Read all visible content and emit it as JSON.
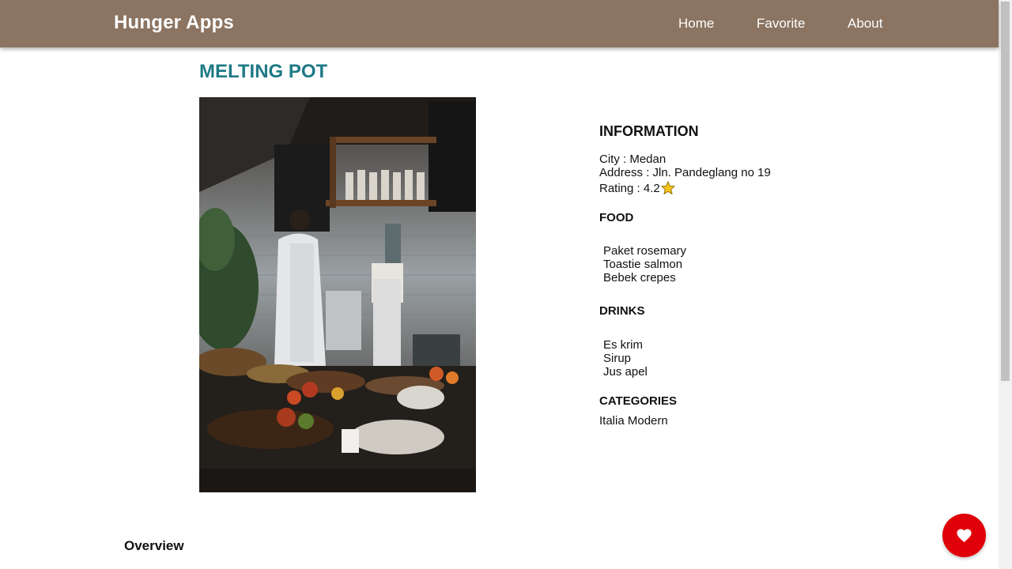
{
  "app": {
    "title": "Hunger Apps"
  },
  "nav": [
    {
      "label": "Home"
    },
    {
      "label": "Favorite"
    },
    {
      "label": "About"
    }
  ],
  "restaurant": {
    "name": "MELTING POT",
    "info_heading": "INFORMATION",
    "city_text": "City : Medan",
    "address_text": "Address : Jln. Pandeglang no 19",
    "rating_text": "Rating : 4.2",
    "rating_icon": "star-icon",
    "food_heading": "FOOD",
    "foods": [
      "Paket rosemary",
      "Toastie salmon",
      "Bebek crepes"
    ],
    "drinks_heading": "DRINKS",
    "drinks": [
      "Es krim",
      "Sirup",
      "Jus apel"
    ],
    "categories_heading": "CATEGORIES",
    "categories": "Italia Modern"
  },
  "overview_heading": "Overview",
  "favorite_button": {
    "icon": "heart-icon",
    "color": "#e0000a"
  },
  "colors": {
    "appbar": "#8b7461",
    "title": "#1e7a86",
    "star": "#f5c518"
  }
}
